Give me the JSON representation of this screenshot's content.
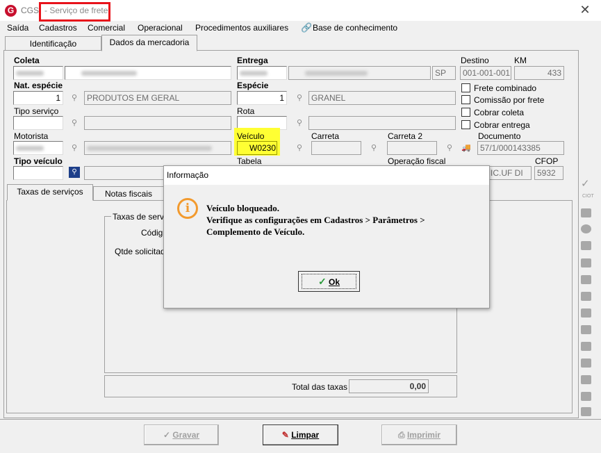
{
  "window": {
    "app_logo": "G",
    "app_name": "CGS",
    "title": "- Serviço de frete",
    "close_glyph": "✕"
  },
  "menu": [
    "Saída",
    "Cadastros",
    "Comercial",
    "Operacional",
    "Procedimentos auxiliares",
    "Base de conhecimento"
  ],
  "tabs": {
    "identificacao": "Identificação",
    "dados_mercadoria": "Dados da mercadoria"
  },
  "form": {
    "coleta_label": "Coleta",
    "entrega_label": "Entrega",
    "destino_label": "Destino",
    "km_label": "KM",
    "entrega_uf": "SP",
    "destino_value": "001-001-001",
    "km_value": "433",
    "nat_especie_label": "Nat. espécie",
    "nat_especie_code": "1",
    "nat_especie_desc": "PRODUTOS EM GERAL",
    "especie_label": "Espécie",
    "especie_code": "1",
    "especie_desc": "GRANEL",
    "frete_combinado": "Frete combinado",
    "comissao_frete": "Comissão por frete",
    "cobrar_coleta": "Cobrar coleta",
    "cobrar_entrega": "Cobrar entrega",
    "tipo_servico_label": "Tipo serviço",
    "rota_label": "Rota",
    "motorista_label": "Motorista",
    "veiculo_label": "Veículo",
    "veiculo_value": "W0230",
    "carreta_label": "Carreta",
    "carreta2_label": "Carreta 2",
    "documento_label": "Documento",
    "documento_value": "57/1/000143385",
    "tipo_veiculo_label": "Tipo veículo",
    "tabela_label": "Tabela",
    "operacao_fiscal_label": "Operação fiscal",
    "operacao_fiscal_value": "INIC.UF DI",
    "cfop_label": "CFOP",
    "cfop_value": "5932"
  },
  "subtabs": {
    "taxas": "Taxas de serviços",
    "notas": "Notas fiscais"
  },
  "taxas_panel": {
    "group_title": "Taxas de servi",
    "codigo_label": "Códig",
    "qtde_label": "Qtde solicitada",
    "total_label": "Total das taxas",
    "total_value": "0,00"
  },
  "buttons": {
    "gravar": "Gravar",
    "limpar": "Limpar",
    "imprimir": "Imprimir"
  },
  "dialog": {
    "title": "Informação",
    "icon": "i",
    "line1": "Veículo bloqueado.",
    "line2": "Verifique as configurações em Cadastros > Parâmetros >",
    "line3": "Complemento de Veículo.",
    "ok_label": "Ok"
  },
  "colors": {
    "highlight_red": "#e8121a",
    "highlight_yellow": "#ffff33",
    "info_orange": "#f29a2e"
  }
}
